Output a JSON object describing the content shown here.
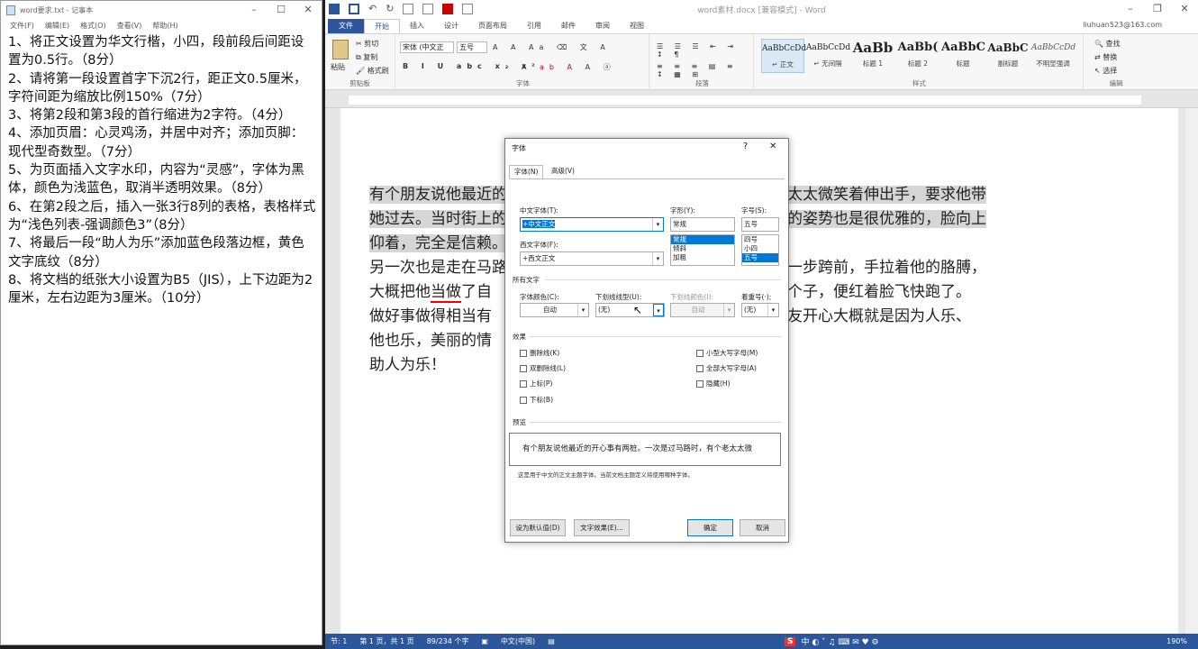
{
  "notepad": {
    "title": "word要求.txt - 记事本",
    "menu": [
      "文件(F)",
      "编辑(E)",
      "格式(O)",
      "查看(V)",
      "帮助(H)"
    ],
    "lines": [
      "1、将正文设置为华文行楷，小四，段前段后间距设置为0.5行。（8分）",
      "2、请将第一段设置首字下沉2行，距正文0.5厘米，字符间距为缩放比例150%（7分）",
      "3、将第2段和第3段的首行缩进为2字符。（4分）",
      "4、添加页眉：心灵鸡汤，并居中对齐；添加页脚：现代型奇数型。（7分）",
      "5、为页面插入文字水印，内容为“灵感”，字体为黑体，颜色为浅蓝色，取消半透明效果。（8分）",
      "6、在第2段之后，插入一张3行8列的表格，表格样式为“浅色列表-强调颜色3”（8分）",
      "7、将最后一段“助人为乐”添加蓝色段落边框，黄色文字底纹（8分）",
      "8、将文档的纸张大小设置为B5（JIS），上下边距为2厘米，左右边距为3厘米。（10分）"
    ]
  },
  "word": {
    "title": "word素材.docx [兼容模式] - Word",
    "tabs": [
      "文件",
      "开始",
      "插入",
      "设计",
      "页面布局",
      "引用",
      "邮件",
      "审阅",
      "视图"
    ],
    "account": "liuhuan523@163.com",
    "ribbon": {
      "clipboard": {
        "paste": "粘贴",
        "cut": "剪切",
        "copy": "复制",
        "painter": "格式刷",
        "label": "剪贴板"
      },
      "font": {
        "name": "宋体 (中文正",
        "size": "五号",
        "label": "字体"
      },
      "paragraph": {
        "label": "段落"
      },
      "styles": {
        "label": "样式",
        "items": [
          {
            "preview": "AaBbCcDd",
            "name": "↵ 正文"
          },
          {
            "preview": "AaBbCcDd",
            "name": "↵ 无间隔"
          },
          {
            "preview": "AaBb",
            "name": "标题 1"
          },
          {
            "preview": "AaBb(",
            "name": "标题 2"
          },
          {
            "preview": "AaBbC",
            "name": "标题"
          },
          {
            "preview": "AaBbC",
            "name": "副标题"
          },
          {
            "preview": "AaBbCcDd",
            "name": "不明显强调"
          }
        ]
      },
      "editing": {
        "find": "查找",
        "replace": "替换",
        "select": "选择",
        "label": "编辑"
      }
    },
    "document": {
      "p1_a": "有个朋友说他最近的",
      "p1_b": "个老太太微笑着伸出手，要求他带",
      "p1_c": "她过去。当时街上的",
      "p1_d": "个他的姿势也是很优雅的，脸向上",
      "p1_e": "仰着，完全是信赖。",
      "p2_a": "另一次也是走在马路",
      "p2_b": "路，一步跨前，手拉着他的胳膊，",
      "p2_c1": "大概把他",
      "p2_c2": "当做",
      "p2_c3": "了自",
      "p2_d": "陌生大个子，便红着脸飞快跑了。",
      "p2_e": "做好事做得相当有",
      "p2_f": "了，朋友开心大概就是因为人乐、",
      "p2_g": "他也乐，美丽的情",
      "p3": "助人为乐！"
    },
    "status": {
      "section": "节: 1",
      "page": "第 1 页，共 1 页",
      "words": "89/234 个字",
      "lang": "中文(中国)",
      "zoom": "190%"
    }
  },
  "dialog": {
    "title": "字体",
    "help": "?",
    "close": "✕",
    "tabs": [
      "字体(N)",
      "高级(V)"
    ],
    "cn_font_label": "中文字体(T):",
    "cn_font_value": "+中文正文",
    "west_font_label": "西文字体(F):",
    "west_font_value": "+西文正文",
    "style_label": "字形(Y):",
    "style_value": "常规",
    "style_options": [
      "常规",
      "倾斜",
      "加粗"
    ],
    "size_label": "字号(S):",
    "size_value": "五号",
    "size_options": [
      "四号",
      "小四",
      "五号"
    ],
    "all_text": "所有文字",
    "font_color_label": "字体颜色(C):",
    "font_color_value": "自动",
    "underline_label": "下划线线型(U):",
    "underline_value": "(无)",
    "underline_color_label": "下划线颜色(I):",
    "underline_color_value": "自动",
    "emphasis_label": "着重号(·);",
    "emphasis_value": "(无)",
    "effects": "效果",
    "effects_left": [
      "删除线(K)",
      "双删除线(L)",
      "上标(P)",
      "下标(B)"
    ],
    "effects_right": [
      "小型大写字母(M)",
      "全部大写字母(A)",
      "隐藏(H)"
    ],
    "preview_label": "预览",
    "preview_text": "有个朋友说他最近的开心事有两桩。一次是过马路时，有个老太太微",
    "preview_note": "这是用于中文的正文主题字体。当前文档主题定义将使用哪种字体。",
    "btn_default": "设为默认值(D)",
    "btn_effects": "文字效果(E)...",
    "btn_ok": "确定",
    "btn_cancel": "取消"
  }
}
